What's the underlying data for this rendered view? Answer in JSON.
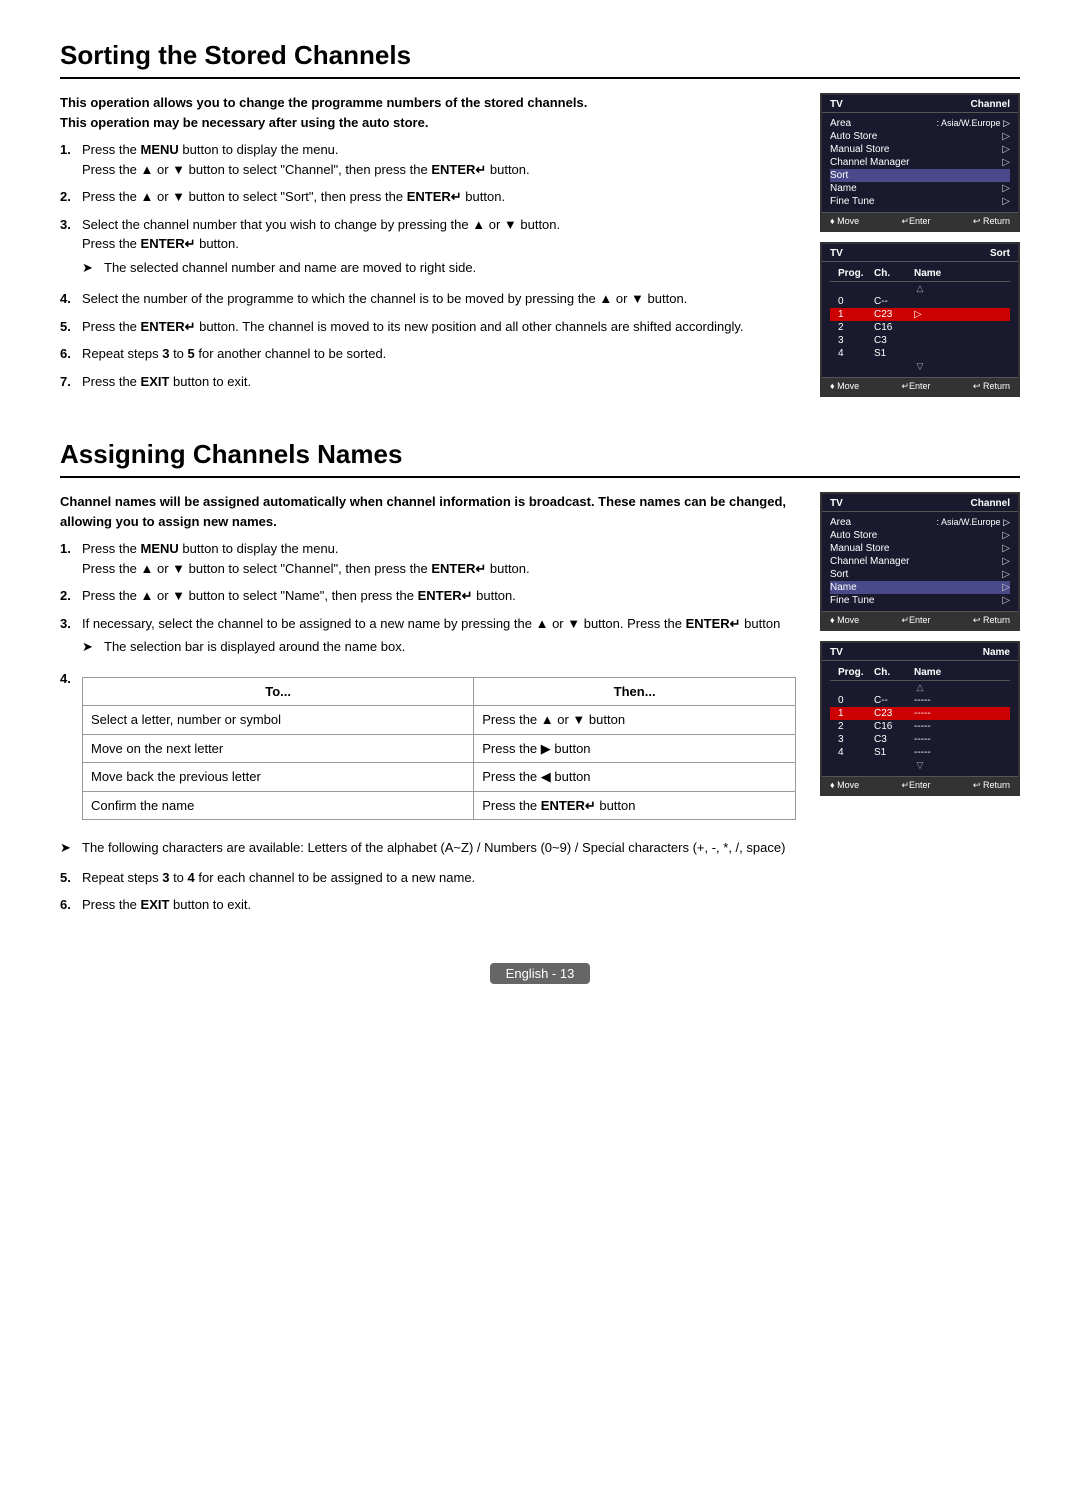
{
  "page": {
    "footer_text": "English - 13"
  },
  "sorting_section": {
    "title": "Sorting the Stored Channels",
    "intro_line1": "This operation allows you to change the programme numbers of the stored channels.",
    "intro_line2": "This operation may be necessary after using the auto store.",
    "steps": [
      {
        "num": "1.",
        "lines": [
          "Press the MENU button to display the menu.",
          "Press the ▲ or ▼ button to select \"Channel\", then press the ENTER↵ button."
        ],
        "bold_words": [
          "MENU",
          "ENTER↵"
        ]
      },
      {
        "num": "2.",
        "lines": [
          "Press the ▲ or ▼ button to select \"Sort\", then press the ENTER↵ button."
        ],
        "bold_words": [
          "ENTER↵"
        ]
      },
      {
        "num": "3.",
        "lines": [
          "Select the channel number that you wish to change by pressing the ▲ or ▼ button.",
          "Press the ENTER↵ button."
        ],
        "bold_words": [
          "ENTER↵"
        ],
        "note": "The selected channel number and name are moved to right side."
      },
      {
        "num": "4.",
        "lines": [
          "Select the number of the programme to which the channel is to be moved by pressing the ▲ or ▼ button."
        ]
      },
      {
        "num": "5.",
        "lines": [
          "Press the ENTER↵ button. The channel is moved to its new position and all other channels are shifted accordingly."
        ],
        "bold_words": [
          "ENTER↵"
        ]
      },
      {
        "num": "6.",
        "lines": [
          "Repeat steps 3 to 5 for another channel to be sorted."
        ],
        "bold_words": [
          "3",
          "5"
        ]
      },
      {
        "num": "7.",
        "lines": [
          "Press the EXIT button to exit."
        ],
        "bold_words": [
          "EXIT"
        ]
      }
    ],
    "diagrams": {
      "channel_menu": {
        "header_left": "TV",
        "header_right": "Channel",
        "rows": [
          {
            "label": "Area",
            "value": ": Asia/W.Europe",
            "arrow": "▷",
            "highlighted": false
          },
          {
            "label": "Auto Store",
            "value": "",
            "arrow": "▷",
            "highlighted": false
          },
          {
            "label": "Manual Store",
            "value": "",
            "arrow": "▷",
            "highlighted": false
          },
          {
            "label": "Channel Manager",
            "value": "",
            "arrow": "▷",
            "highlighted": false
          },
          {
            "label": "Sort",
            "value": "",
            "arrow": "",
            "highlighted": true
          },
          {
            "label": "Name",
            "value": "",
            "arrow": "▷",
            "highlighted": false
          },
          {
            "label": "Fine Tune",
            "value": "",
            "arrow": "▷",
            "highlighted": false
          }
        ],
        "footer": [
          "♦ Move",
          "↵Enter",
          "↩ Return"
        ]
      },
      "sort_menu": {
        "header_left": "TV",
        "header_right": "Sort",
        "col_headers": [
          "Prog.",
          "Ch.",
          "Name"
        ],
        "rows": [
          {
            "prog": "0",
            "ch": "C--",
            "name": "",
            "up": true,
            "highlighted": false
          },
          {
            "prog": "1",
            "ch": "C23",
            "name": "",
            "highlighted": true,
            "arrow": "▷"
          },
          {
            "prog": "2",
            "ch": "C16",
            "name": "",
            "highlighted": false
          },
          {
            "prog": "3",
            "ch": "C3",
            "name": "",
            "highlighted": false
          },
          {
            "prog": "4",
            "ch": "S1",
            "name": "",
            "highlighted": false,
            "down": true
          }
        ],
        "footer": [
          "♦ Move",
          "↵Enter",
          "↩ Return"
        ]
      }
    }
  },
  "assigning_section": {
    "title": "Assigning Channels Names",
    "intro": "Channel names will be assigned automatically when channel information is broadcast. These names can be changed, allowing you to assign new names.",
    "steps": [
      {
        "num": "1.",
        "lines": [
          "Press the MENU button to display the menu.",
          "Press the ▲ or ▼ button to select \"Channel\", then press the ENTER↵ button."
        ],
        "bold_words": [
          "MENU",
          "ENTER↵"
        ]
      },
      {
        "num": "2.",
        "lines": [
          "Press the ▲ or ▼ button to select \"Name\", then press the ENTER↵ button."
        ],
        "bold_words": [
          "ENTER↵"
        ]
      },
      {
        "num": "3.",
        "lines": [
          "If necessary, select the channel to be assigned to a new name by pressing the ▲ or ▼ button. Press the ENTER↵ button"
        ],
        "bold_words": [
          "ENTER↵"
        ],
        "note": "The selection bar is displayed around the name box."
      },
      {
        "num": "4.",
        "table": {
          "headers": [
            "To...",
            "Then..."
          ],
          "rows": [
            [
              "Select a letter, number or symbol",
              "Press the ▲ or ▼ button"
            ],
            [
              "Move on the next letter",
              "Press the ▶ button"
            ],
            [
              "Move back the previous letter",
              "Press the ◀ button"
            ],
            [
              "Confirm the name",
              "Press the ENTER↵ button"
            ]
          ]
        }
      }
    ],
    "note_bottom": "The following characters are available: Letters of the alphabet (A~Z) / Numbers (0~9) / Special characters (+, -, *, /, space)",
    "steps_after": [
      {
        "num": "5.",
        "lines": [
          "Repeat steps 3 to 4 for each channel to be assigned to a new name."
        ],
        "bold_words": [
          "3",
          "4"
        ]
      },
      {
        "num": "6.",
        "lines": [
          "Press the EXIT button to exit."
        ],
        "bold_words": [
          "EXIT"
        ]
      }
    ],
    "diagrams": {
      "channel_menu": {
        "header_left": "TV",
        "header_right": "Channel",
        "rows": [
          {
            "label": "Area",
            "value": ": Asia/W.Europe",
            "arrow": "▷",
            "highlighted": false
          },
          {
            "label": "Auto Store",
            "value": "",
            "arrow": "▷",
            "highlighted": false
          },
          {
            "label": "Manual Store",
            "value": "",
            "arrow": "▷",
            "highlighted": false
          },
          {
            "label": "Channel Manager",
            "value": "",
            "arrow": "▷",
            "highlighted": false
          },
          {
            "label": "Sort",
            "value": "",
            "arrow": "▷",
            "highlighted": false
          },
          {
            "label": "Name",
            "value": "",
            "arrow": "▷",
            "highlighted": true
          },
          {
            "label": "Fine Tune",
            "value": "",
            "arrow": "▷",
            "highlighted": false
          }
        ],
        "footer": [
          "♦ Move",
          "↵Enter",
          "↩ Return"
        ]
      },
      "name_menu": {
        "header_left": "TV",
        "header_right": "Name",
        "col_headers": [
          "Prog.",
          "Ch.",
          "Name"
        ],
        "rows": [
          {
            "prog": "0",
            "ch": "C--",
            "name": "-----",
            "highlighted": false,
            "up": true
          },
          {
            "prog": "1",
            "ch": "C23",
            "name": "-----",
            "highlighted": true
          },
          {
            "prog": "2",
            "ch": "C16",
            "name": "-----",
            "highlighted": false
          },
          {
            "prog": "3",
            "ch": "C3",
            "name": "-----",
            "highlighted": false
          },
          {
            "prog": "4",
            "ch": "S1",
            "name": "-----",
            "highlighted": false,
            "down": true
          }
        ],
        "footer": [
          "♦ Move",
          "↵Enter",
          "↩ Return"
        ]
      }
    }
  }
}
